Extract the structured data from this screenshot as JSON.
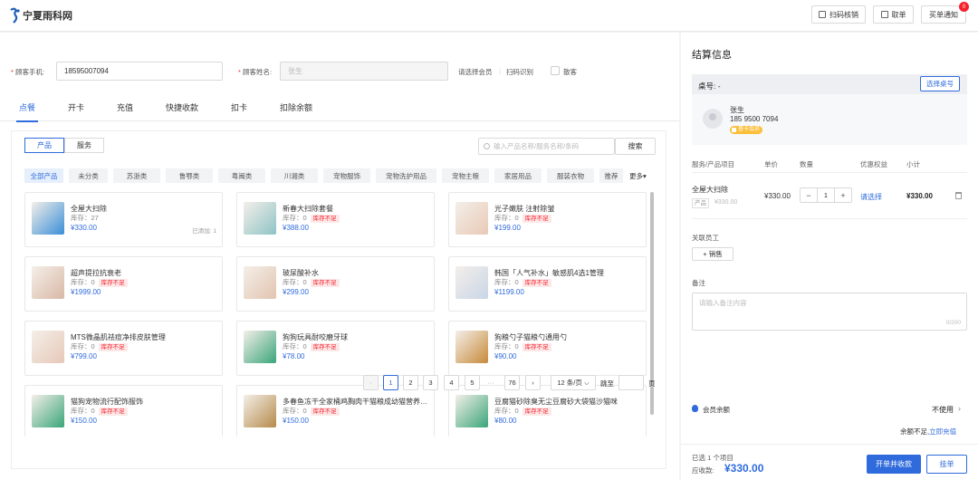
{
  "brand": {
    "name": "宁夏雨科网"
  },
  "topbar": {
    "scan_verify": "扫码核销",
    "orders": "取单",
    "buy_notice": "买单通知",
    "notice_count": "0"
  },
  "customer_form": {
    "phone_label": "顾客手机:",
    "phone_value": "18595007094",
    "name_label": "顾客姓名:",
    "name_value": "张生",
    "select_member": "请选择会员",
    "scan_recognize": "扫码识别",
    "walk_in": "散客"
  },
  "tabs": [
    "点餐",
    "开卡",
    "充值",
    "快捷收款",
    "扣卡",
    "扣除余额"
  ],
  "segments": [
    "产品",
    "服务"
  ],
  "search": {
    "placeholder": "输入产品名称/服务名称/条码",
    "button": "搜索"
  },
  "categories": [
    "全部产品",
    "未分类",
    "苏浙类",
    "鲁鄂类",
    "粤闽类",
    "川湘类",
    "宠物服饰",
    "宠物洗护用品",
    "宠物主粮",
    "家居用品",
    "服装衣物",
    "推荐"
  ],
  "more_label": "更多▾",
  "products": [
    {
      "name": "全屋大扫除",
      "stock": "库存：27",
      "short": "",
      "price": "¥330.00",
      "added": "已添加: 1",
      "icon": "cleaning-product-image",
      "color": "#3a8fd8"
    },
    {
      "name": "新春大扫除套餐",
      "stock": "库存：0",
      "short": "库存不足",
      "price": "¥388.00",
      "added": "",
      "icon": "spray-bottles-image",
      "color": "#8fc3c6"
    },
    {
      "name": "光子嫩肤 注射除皱",
      "stock": "库存：0",
      "short": "库存不足",
      "price": "¥199.00",
      "added": "",
      "icon": "face-skincare-image",
      "color": "#e8c9b5"
    },
    {
      "name": "超声提拉抗衰老",
      "stock": "库存：0",
      "short": "库存不足",
      "price": "¥1999.00",
      "added": "",
      "icon": "face-treatment-image",
      "color": "#d9b8a6"
    },
    {
      "name": "玻尿酸补水",
      "stock": "库存：0",
      "short": "库存不足",
      "price": "¥299.00",
      "added": "",
      "icon": "face-hydration-image",
      "color": "#e2c4b0"
    },
    {
      "name": "韩国「人气补水」敏感肌4选1管理",
      "stock": "库存：0",
      "short": "库存不足",
      "price": "¥1199.00",
      "added": "",
      "icon": "face-mask-image",
      "color": "#c9d6e8"
    },
    {
      "name": "MTS微晶肌祛痘净排皮肤管理",
      "stock": "库存：0",
      "short": "库存不足",
      "price": "¥799.00",
      "added": "",
      "icon": "facial-massage-image",
      "color": "#e6c8b8"
    },
    {
      "name": "狗狗玩具耐咬磨牙球",
      "stock": "库存：0",
      "short": "库存不足",
      "price": "¥78.00",
      "added": "",
      "icon": "dog-toy-image",
      "color": "#3aa57a"
    },
    {
      "name": "狗粮勺子猫粮勺通用勺",
      "stock": "库存：0",
      "short": "库存不足",
      "price": "¥90.00",
      "added": "",
      "icon": "pet-food-spoon-image",
      "color": "#c78a3a"
    },
    {
      "name": "猫狗宠物流行配饰服饰",
      "stock": "库存：0",
      "short": "库存不足",
      "price": "¥150.00",
      "added": "",
      "icon": "pet-clothes-image",
      "color": "#3aa57a"
    },
    {
      "name": "多春鱼冻干全家桶鸡胸肉干猫粮成幼猫营养零食",
      "stock": "库存：0",
      "short": "库存不足",
      "price": "¥150.00",
      "added": "",
      "icon": "pet-snack-image",
      "color": "#b58a4a"
    },
    {
      "name": "豆腐猫砂除臭无尘豆腐砂大袋猫沙猫咪",
      "stock": "库存：0",
      "short": "库存不足",
      "price": "¥80.00",
      "added": "",
      "icon": "cat-litter-image",
      "color": "#3aa57a"
    }
  ],
  "pagination": {
    "pages": [
      "1",
      "2",
      "3",
      "4",
      "5",
      "···",
      "76"
    ],
    "page_size": "12 条/页",
    "goto_label": "跳至",
    "page_suffix": "页"
  },
  "checkout": {
    "title": "结算信息",
    "table_label": "桌号: -",
    "select_table": "选择桌号",
    "customer_name": "张生",
    "customer_phone": "185 9500 7094",
    "member_badge": "普卡会员",
    "headers": [
      "服务/产品项目",
      "单价",
      "数量",
      "优惠权益",
      "小计"
    ],
    "item": {
      "name": "全屋大扫除",
      "tag": "产品",
      "orig_price": "¥330.00",
      "unit_price": "¥330.00",
      "qty": "1",
      "discount": "请选择",
      "subtotal": "¥330.00"
    },
    "staff_label": "关联员工",
    "add_staff": "+ 销售",
    "remark_label": "备注",
    "remark_placeholder": "请输入备注内容",
    "remark_count": "0/200",
    "balance_label": "会员余额",
    "balance_value": "不使用",
    "balance_note": "余额不足,",
    "recharge_link": "立即充值",
    "selected_count": "已选 1 个项目",
    "due_label": "应收款:",
    "due_value": "¥330.00",
    "pay_button": "开单并收款",
    "hold_button": "挂单"
  }
}
